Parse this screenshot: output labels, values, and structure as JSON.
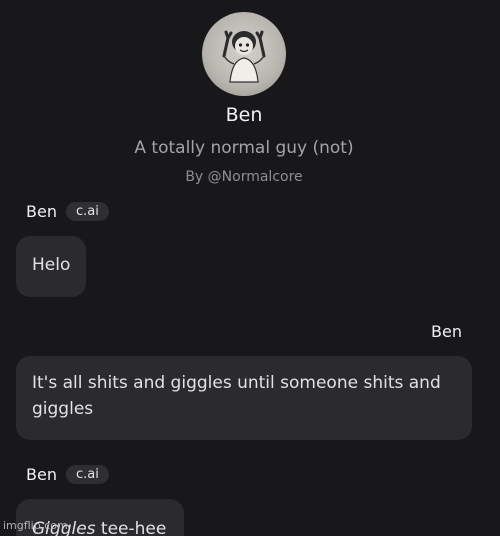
{
  "character": {
    "name": "Ben",
    "tagline": "A totally normal guy (not)",
    "creator": "By @Normalcore"
  },
  "messages": [
    {
      "sender": "Ben",
      "badge": "c.ai",
      "text": "Helo",
      "side": "left"
    },
    {
      "sender": "Ben",
      "text": "It's all shits and giggles until someone shits and giggles",
      "side": "right"
    },
    {
      "sender": "Ben",
      "badge": "c.ai",
      "text_italic": "Giggles",
      "text_rest": " tee-hee",
      "side": "left"
    }
  ],
  "watermark": "imgflip.com",
  "colors": {
    "background": "#18181b",
    "bubble": "#2a2a2f",
    "badge": "#2e2e33"
  }
}
